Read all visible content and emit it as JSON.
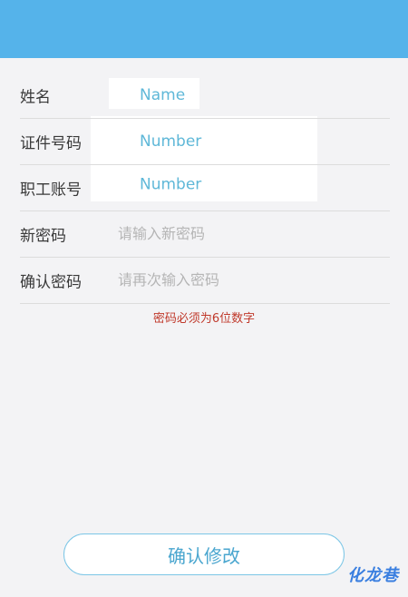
{
  "form": {
    "name_label": "姓名",
    "name_value": "Name",
    "id_label": "证件号码",
    "id_value": "Number",
    "staff_label": "职工账号",
    "staff_value": "Number",
    "new_password_label": "新密码",
    "new_password_placeholder": "请输入新密码",
    "confirm_password_label": "确认密码",
    "confirm_password_placeholder": "请再次输入密码"
  },
  "hint": "密码必须为6位数字",
  "submit_label": "确认修改",
  "watermark": "化龙巷",
  "colors": {
    "header": "#55b3ea",
    "hint": "#c0392b",
    "button_text": "#4aa6cf"
  }
}
